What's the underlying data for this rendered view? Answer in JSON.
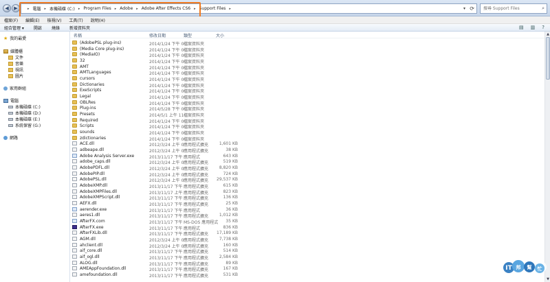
{
  "address_bar": {
    "segments": [
      "電腦",
      "本機磁碟 (C:)",
      "Program Files",
      "Adobe",
      "Adobe After Effects CS6",
      "Support Files"
    ],
    "search_placeholder": "搜尋 Support Files"
  },
  "menu": {
    "items": [
      "檔案(F)",
      "編輯(E)",
      "檢視(V)",
      "工具(T)",
      "說明(H)"
    ]
  },
  "toolbar": {
    "items": [
      "組合管理 ▾",
      "開啟",
      "燒錄",
      "新增資料夾"
    ]
  },
  "sidebar": {
    "favorites": "我的最愛",
    "libraries": "媒體櫃",
    "library_items": [
      "文件",
      "音樂",
      "視訊",
      "圖片"
    ],
    "homegroup": "家用群組",
    "computer": "電腦",
    "drives": [
      "本機磁碟 (C:)",
      "本機磁碟 (D:)",
      "本機磁碟 (E:)",
      "系統保留 (G:)"
    ],
    "network": "網路"
  },
  "columns": {
    "name": "名稱",
    "date": "修改日期",
    "type": "類型",
    "size": "大小"
  },
  "files": [
    {
      "name": "(AdobePSL plug-ins)",
      "date": "2014/1/24 下午 0...",
      "type": "檔案資料夾",
      "size": "",
      "icon": "folder"
    },
    {
      "name": "(Media Core plug-ins)",
      "date": "2014/1/24 下午 0...",
      "type": "檔案資料夾",
      "size": "",
      "icon": "folder"
    },
    {
      "name": "(MediaIO)",
      "date": "2014/1/24 下午 0...",
      "type": "檔案資料夾",
      "size": "",
      "icon": "folder"
    },
    {
      "name": "32",
      "date": "2014/1/24 下午 0...",
      "type": "檔案資料夾",
      "size": "",
      "icon": "folder"
    },
    {
      "name": "AMT",
      "date": "2014/1/24 下午 0...",
      "type": "檔案資料夾",
      "size": "",
      "icon": "folder"
    },
    {
      "name": "AMTLanguages",
      "date": "2014/1/24 下午 0...",
      "type": "檔案資料夾",
      "size": "",
      "icon": "folder"
    },
    {
      "name": "cursors",
      "date": "2014/1/24 下午 0...",
      "type": "檔案資料夾",
      "size": "",
      "icon": "folder"
    },
    {
      "name": "Dictionaries",
      "date": "2014/1/24 下午 0...",
      "type": "檔案資料夾",
      "size": "",
      "icon": "folder"
    },
    {
      "name": "ExeScripts",
      "date": "2014/1/24 下午 0...",
      "type": "檔案資料夾",
      "size": "",
      "icon": "folder"
    },
    {
      "name": "Legal",
      "date": "2014/1/24 下午 0...",
      "type": "檔案資料夾",
      "size": "",
      "icon": "folder"
    },
    {
      "name": "OBLRes",
      "date": "2014/1/24 下午 0...",
      "type": "檔案資料夾",
      "size": "",
      "icon": "folder"
    },
    {
      "name": "Plug-ins",
      "date": "2014/5/28 下午 0...",
      "type": "檔案資料夾",
      "size": "",
      "icon": "folder"
    },
    {
      "name": "Presets",
      "date": "2014/5/1 上午 11...",
      "type": "檔案資料夾",
      "size": "",
      "icon": "folder"
    },
    {
      "name": "Required",
      "date": "2014/1/24 下午 0...",
      "type": "檔案資料夾",
      "size": "",
      "icon": "folder"
    },
    {
      "name": "Scripts",
      "date": "2014/1/24 下午 0...",
      "type": "檔案資料夾",
      "size": "",
      "icon": "folder"
    },
    {
      "name": "sounds",
      "date": "2014/1/24 下午 0...",
      "type": "檔案資料夾",
      "size": "",
      "icon": "folder"
    },
    {
      "name": "zdictionaries",
      "date": "2014/1/24 下午 0...",
      "type": "檔案資料夾",
      "size": "",
      "icon": "folder"
    },
    {
      "name": "ACE.dll",
      "date": "2012/3/24 上午 0...",
      "type": "應用程式擴充",
      "size": "1,601 KB",
      "icon": "dll"
    },
    {
      "name": "adbeape.dll",
      "date": "2012/3/24 上午 0...",
      "type": "應用程式擴充",
      "size": "38 KB",
      "icon": "dll"
    },
    {
      "name": "Adobe Analysis Server.exe",
      "date": "2013/11/17 下午 ...",
      "type": "應用程式",
      "size": "643 KB",
      "icon": "exe"
    },
    {
      "name": "adobe_caps.dll",
      "date": "2012/3/24 上午 0...",
      "type": "應用程式擴充",
      "size": "519 KB",
      "icon": "dll"
    },
    {
      "name": "AdobePDFL.dll",
      "date": "2012/3/24 上午 0...",
      "type": "應用程式擴充",
      "size": "8,820 KB",
      "icon": "dll"
    },
    {
      "name": "AdobePIP.dll",
      "date": "2012/3/24 上午 0...",
      "type": "應用程式擴充",
      "size": "724 KB",
      "icon": "dll"
    },
    {
      "name": "AdobePSL.dll",
      "date": "2012/3/24 上午 0...",
      "type": "應用程式擴充",
      "size": "29,537 KB",
      "icon": "dll"
    },
    {
      "name": "AdobeXMP.dll",
      "date": "2013/11/17 下午 ...",
      "type": "應用程式擴充",
      "size": "615 KB",
      "icon": "dll"
    },
    {
      "name": "AdobeXMPFiles.dll",
      "date": "2013/11/17 上午 ...",
      "type": "應用程式擴充",
      "size": "823 KB",
      "icon": "dll"
    },
    {
      "name": "AdobeXMPScript.dll",
      "date": "2013/11/17 下午 ...",
      "type": "應用程式擴充",
      "size": "136 KB",
      "icon": "dll"
    },
    {
      "name": "AEFX.dll",
      "date": "2013/11/17 下午 ...",
      "type": "應用程式擴充",
      "size": "25 KB",
      "icon": "dll"
    },
    {
      "name": "aerender.exe",
      "date": "2013/11/17 下午 ...",
      "type": "應用程式",
      "size": "36 KB",
      "icon": "exe"
    },
    {
      "name": "aeres1.dll",
      "date": "2013/11/17 下午 ...",
      "type": "應用程式擴充",
      "size": "1,012 KB",
      "icon": "dll"
    },
    {
      "name": "AfterFX.com",
      "date": "2013/11/17 下午 ...",
      "type": "MS-DOS 應用程式",
      "size": "35 KB",
      "icon": "exe"
    },
    {
      "name": "AfterFX.exe",
      "date": "2013/11/17 下午 ...",
      "type": "應用程式",
      "size": "836 KB",
      "icon": "ae"
    },
    {
      "name": "AfterFXLib.dll",
      "date": "2013/11/17 下午 ...",
      "type": "應用程式擴充",
      "size": "17,189 KB",
      "icon": "dll"
    },
    {
      "name": "AGM.dll",
      "date": "2012/3/24 上午 0...",
      "type": "應用程式擴充",
      "size": "7,738 KB",
      "icon": "dll"
    },
    {
      "name": "ahclient.dll",
      "date": "2012/3/24 上午 0...",
      "type": "應用程式擴充",
      "size": "160 KB",
      "icon": "dll"
    },
    {
      "name": "aif_core.dll",
      "date": "2013/11/17 下午 ...",
      "type": "應用程式擴充",
      "size": "514 KB",
      "icon": "dll"
    },
    {
      "name": "aif_ogl.dll",
      "date": "2013/11/17 下午 ...",
      "type": "應用程式擴充",
      "size": "2,584 KB",
      "icon": "dll"
    },
    {
      "name": "ALOG.dll",
      "date": "2013/11/17 下午 ...",
      "type": "應用程式擴充",
      "size": "89 KB",
      "icon": "dll"
    },
    {
      "name": "AMEAppFoundation.dll",
      "date": "2013/11/17 下午 ...",
      "type": "應用程式擴充",
      "size": "167 KB",
      "icon": "dll"
    },
    {
      "name": "amefoundation.dll",
      "date": "2013/11/17 下午 ...",
      "type": "應用程式擴充",
      "size": "531 KB",
      "icon": "dll"
    }
  ],
  "watermark": {
    "text": "ITHOME 幫幫忙"
  }
}
